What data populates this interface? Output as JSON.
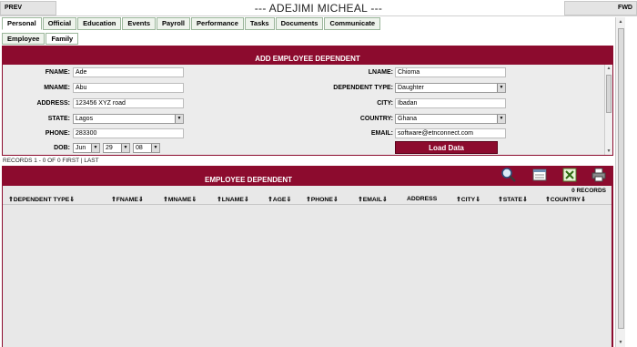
{
  "topbar": {
    "prev": "PREV",
    "fwd": "FWD",
    "employee_name": "--- ADEJIMI MICHEAL ---"
  },
  "tabs": [
    "Personal",
    "Official",
    "Education",
    "Events",
    "Payroll",
    "Performance",
    "Tasks",
    "Documents",
    "Communicate"
  ],
  "subtabs": [
    "Employee",
    "Family"
  ],
  "form": {
    "title": "ADD EMPLOYEE DEPENDENT",
    "fname": {
      "label": "FNAME:",
      "value": "Ade"
    },
    "mname": {
      "label": "MNAME:",
      "value": "Abu"
    },
    "address": {
      "label": "ADDRESS:",
      "value": "123456 XYZ road"
    },
    "state": {
      "label": "STATE:",
      "value": "Lagos"
    },
    "phone": {
      "label": "PHONE:",
      "value": "283300"
    },
    "dob": {
      "label": "DOB:",
      "month": "Jun",
      "day": "29",
      "year": "08"
    },
    "lname": {
      "label": "LNAME:",
      "value": "Chioma"
    },
    "dependent_type": {
      "label": "DEPENDENT TYPE:",
      "value": "Daughter"
    },
    "city": {
      "label": "CITY:",
      "value": "Ibadan"
    },
    "country": {
      "label": "COUNTRY:",
      "value": "Ghana"
    },
    "email": {
      "label": "EMAIL:",
      "value": "software@etnconnect.com"
    },
    "load_button": "Load Data"
  },
  "records_line": "RECORDS 1 - 0 OF 0 FIRST | LAST",
  "grid": {
    "title": "EMPLOYEE DEPENDENT",
    "record_count": "0 RECORDS",
    "columns": [
      "DEPENDENT TYPE",
      "FNAME",
      "MNAME",
      "LNAME",
      "AGE",
      "PHONE",
      "EMAIL",
      "ADDRESS",
      "CITY",
      "STATE",
      "COUNTRY"
    ],
    "toolbar_icons": [
      "search-icon",
      "export-icon",
      "excel-icon",
      "print-icon"
    ]
  },
  "colors": {
    "accent": "#8c0b2e",
    "tab_border": "#9ab69a",
    "panel_bg": "#ececec"
  }
}
